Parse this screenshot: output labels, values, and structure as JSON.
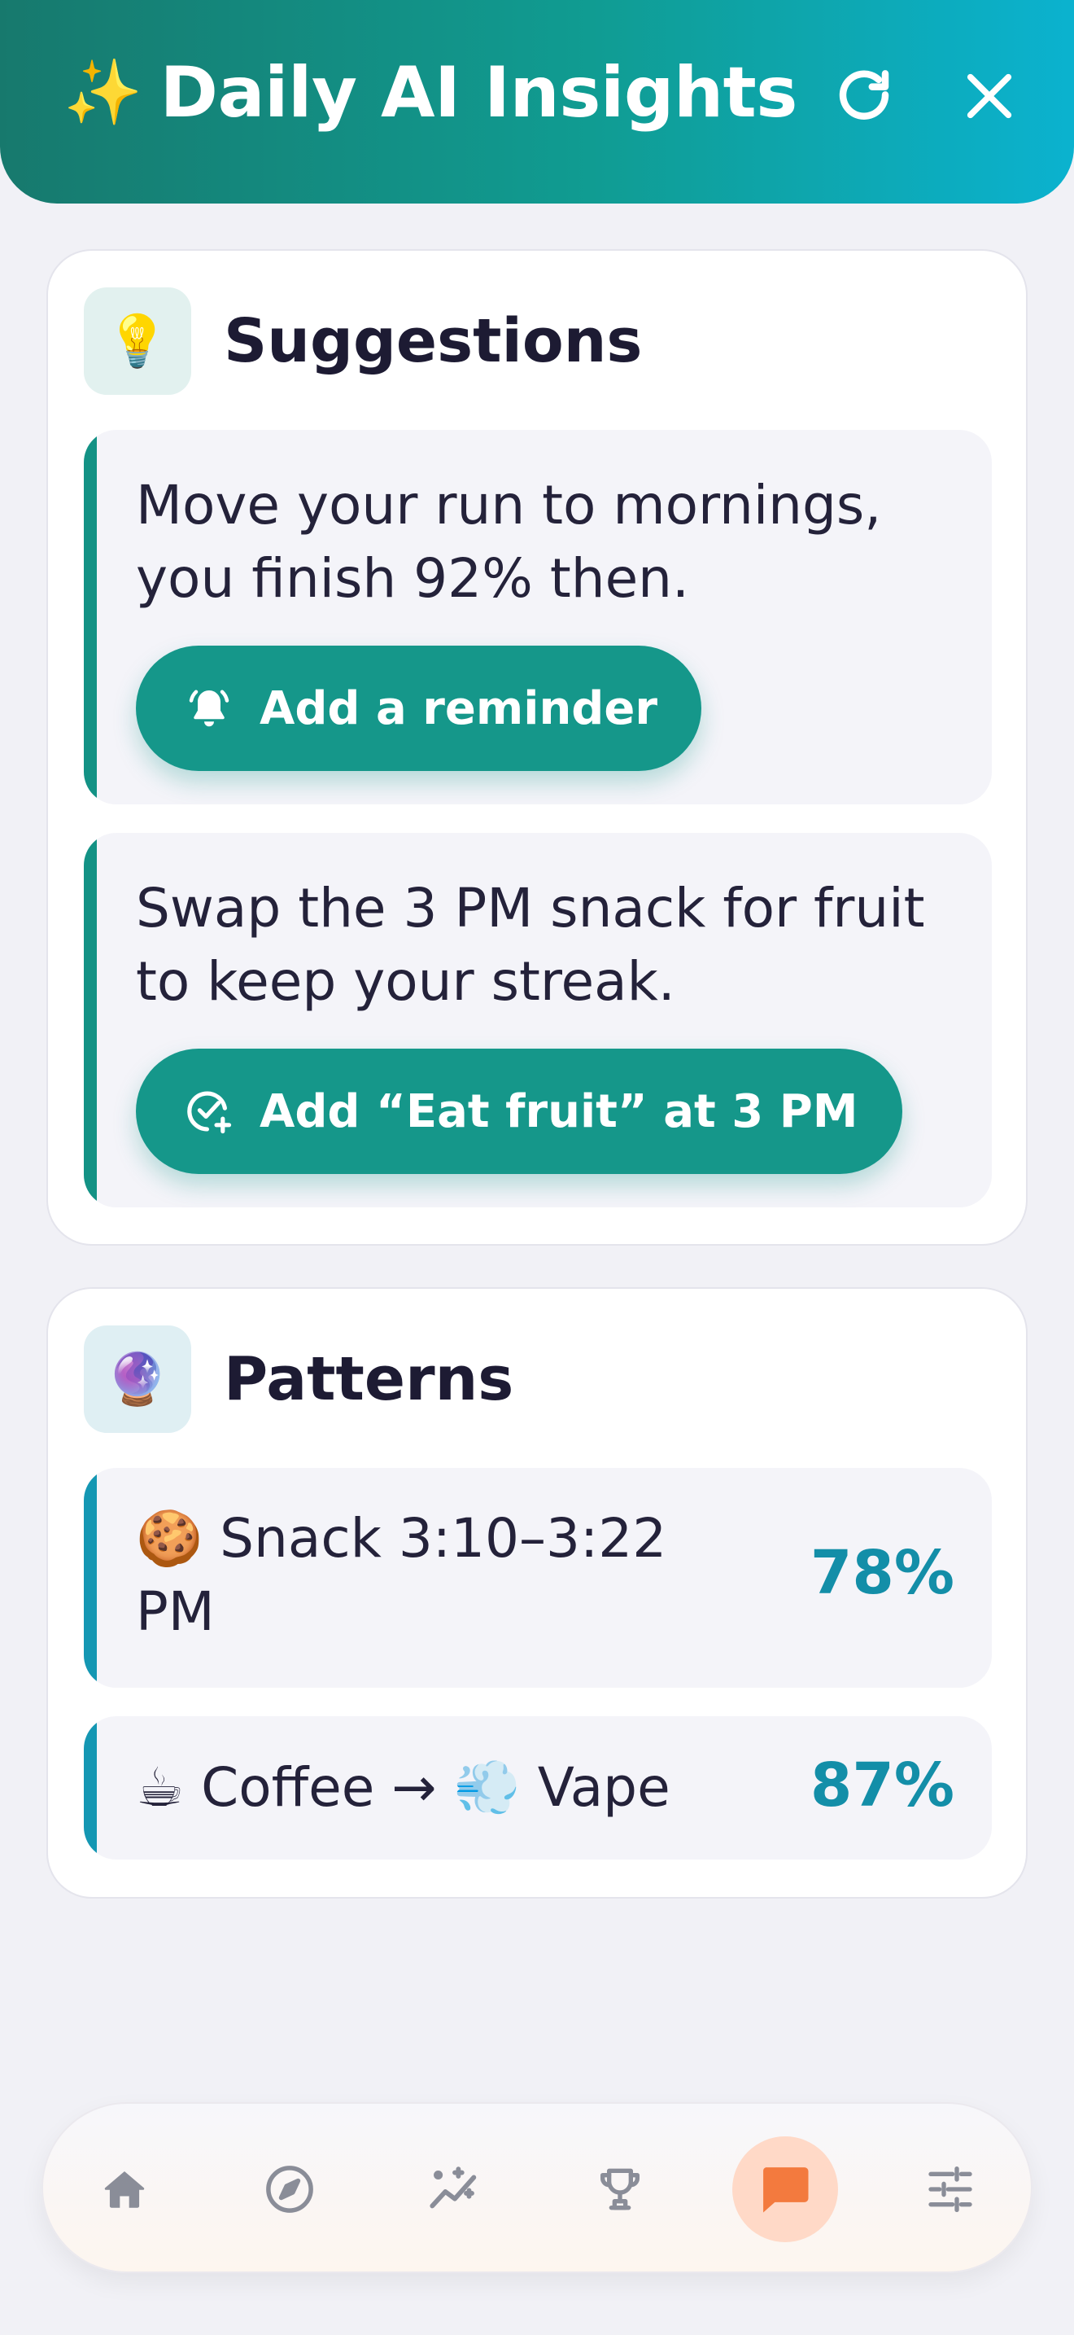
{
  "header": {
    "sparkle": "✨",
    "title": "Daily AI Insights",
    "refresh_icon": "refresh-icon",
    "close_icon": "close-icon"
  },
  "suggestions": {
    "icon": "💡",
    "title": "Suggestions",
    "items": [
      {
        "text": "Move your run to mornings, you finish 92% then.",
        "button_label": "Add a reminder",
        "button_icon": "bell-icon"
      },
      {
        "text": "Swap the 3 PM snack for fruit to keep your streak.",
        "button_label": "Add “Eat fruit” at 3 PM",
        "button_icon": "check-add-icon"
      }
    ]
  },
  "patterns": {
    "icon": "🔮",
    "title": "Patterns",
    "items": [
      {
        "text": "🍪 Snack 3:10–3:22 PM",
        "percent": "78%"
      },
      {
        "text": "☕ Coffee → 💨 Vape",
        "percent": "87%"
      }
    ]
  },
  "nav": {
    "items": [
      {
        "icon": "home-icon",
        "active": false
      },
      {
        "icon": "compass-icon",
        "active": false
      },
      {
        "icon": "trend-icon",
        "active": false
      },
      {
        "icon": "trophy-icon",
        "active": false
      },
      {
        "icon": "chat-icon",
        "active": true
      },
      {
        "icon": "sliders-icon",
        "active": false
      }
    ]
  },
  "colors": {
    "header_gradient_start": "#17796d",
    "header_gradient_end": "#0bb2cf",
    "primary_button": "#15978a",
    "suggestion_accent": "#139285",
    "pattern_accent": "#1497b3",
    "percent_text": "#138ea8",
    "nav_active_bg": "#ffd9c7",
    "nav_active_icon": "#f37a3e",
    "nav_icon": "#8a8d98"
  }
}
